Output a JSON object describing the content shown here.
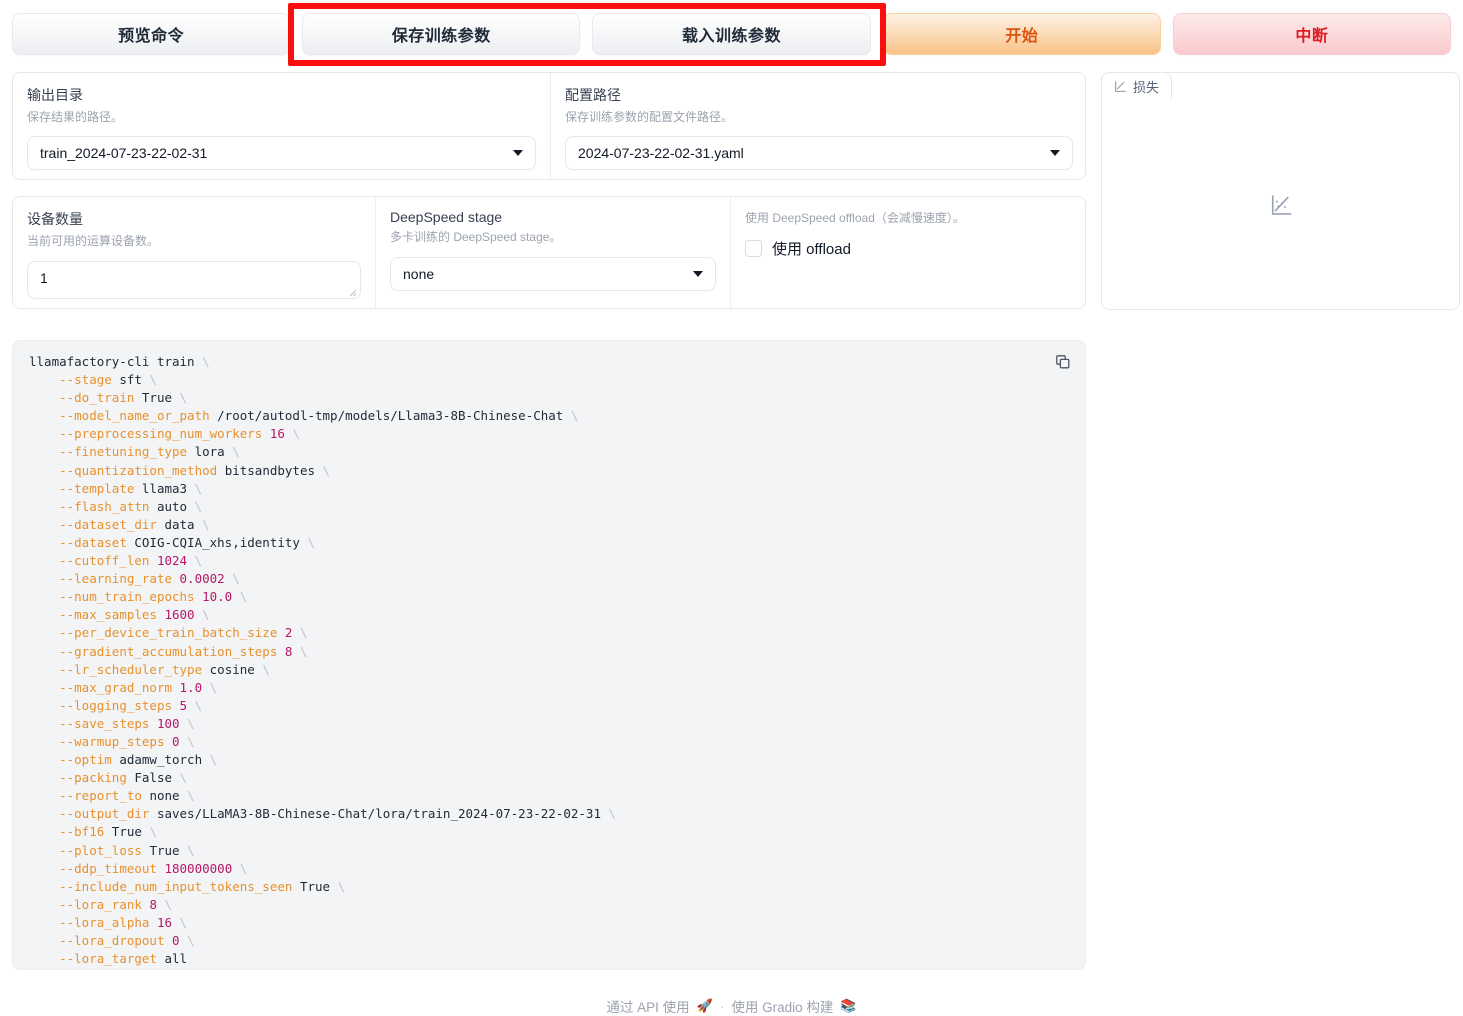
{
  "toolbar": {
    "buttons": [
      {
        "label": "预览命令",
        "style": "grey"
      },
      {
        "label": "保存训练参数",
        "style": "grey"
      },
      {
        "label": "载入训练参数",
        "style": "grey"
      },
      {
        "label": "开始",
        "style": "primary"
      },
      {
        "label": "中断",
        "style": "stop"
      }
    ],
    "annotation_color": "#fa0f0f"
  },
  "output_dir": {
    "label": "输出目录",
    "info": "保存结果的路径。",
    "value": "train_2024-07-23-22-02-31",
    "icon": "chevron-down-icon"
  },
  "config_path": {
    "label": "配置路径",
    "info": "保存训练参数的配置文件路径。",
    "value": "2024-07-23-22-02-31.yaml",
    "icon": "chevron-down-icon"
  },
  "device_count": {
    "label": "设备数量",
    "info": "当前可用的运算设备数。",
    "value": "1"
  },
  "deepspeed_stage": {
    "label": "DeepSpeed stage",
    "info": "多卡训练的 DeepSpeed stage。",
    "value": "none",
    "icon": "chevron-down-icon"
  },
  "offload": {
    "info": "使用 DeepSpeed offload（会减慢速度）。",
    "checkbox_label": "使用 offload",
    "checked": false
  },
  "loss_panel": {
    "tab_label": "损失",
    "tab_icon": "line-chart-icon",
    "placeholder_icon": "line-chart-icon"
  },
  "command": {
    "copy_icon": "copy-icon",
    "lines": [
      {
        "indent": 0,
        "flag": "llamafactory-cli",
        "value": "train",
        "cont": true,
        "flag_plain": true
      },
      {
        "indent": 1,
        "flag": "--stage",
        "value": "sft",
        "cont": true
      },
      {
        "indent": 1,
        "flag": "--do_train",
        "value": "True",
        "cont": true
      },
      {
        "indent": 1,
        "flag": "--model_name_or_path",
        "value": "/root/autodl-tmp/models/Llama3-8B-Chinese-Chat",
        "cont": true
      },
      {
        "indent": 1,
        "flag": "--preprocessing_num_workers",
        "value": "16",
        "num": true,
        "cont": true
      },
      {
        "indent": 1,
        "flag": "--finetuning_type",
        "value": "lora",
        "cont": true
      },
      {
        "indent": 1,
        "flag": "--quantization_method",
        "value": "bitsandbytes",
        "cont": true
      },
      {
        "indent": 1,
        "flag": "--template",
        "value": "llama3",
        "cont": true
      },
      {
        "indent": 1,
        "flag": "--flash_attn",
        "value": "auto",
        "cont": true
      },
      {
        "indent": 1,
        "flag": "--dataset_dir",
        "value": "data",
        "cont": true
      },
      {
        "indent": 1,
        "flag": "--dataset",
        "value": "COIG-CQIA_xhs,identity",
        "cont": true
      },
      {
        "indent": 1,
        "flag": "--cutoff_len",
        "value": "1024",
        "num": true,
        "cont": true
      },
      {
        "indent": 1,
        "flag": "--learning_rate",
        "value": "0.0002",
        "num": true,
        "cont": true
      },
      {
        "indent": 1,
        "flag": "--num_train_epochs",
        "value": "10.0",
        "num": true,
        "cont": true
      },
      {
        "indent": 1,
        "flag": "--max_samples",
        "value": "1600",
        "num": true,
        "cont": true
      },
      {
        "indent": 1,
        "flag": "--per_device_train_batch_size",
        "value": "2",
        "num": true,
        "cont": true
      },
      {
        "indent": 1,
        "flag": "--gradient_accumulation_steps",
        "value": "8",
        "num": true,
        "cont": true
      },
      {
        "indent": 1,
        "flag": "--lr_scheduler_type",
        "value": "cosine",
        "cont": true
      },
      {
        "indent": 1,
        "flag": "--max_grad_norm",
        "value": "1.0",
        "num": true,
        "cont": true
      },
      {
        "indent": 1,
        "flag": "--logging_steps",
        "value": "5",
        "num": true,
        "cont": true
      },
      {
        "indent": 1,
        "flag": "--save_steps",
        "value": "100",
        "num": true,
        "cont": true
      },
      {
        "indent": 1,
        "flag": "--warmup_steps",
        "value": "0",
        "num": true,
        "cont": true
      },
      {
        "indent": 1,
        "flag": "--optim",
        "value": "adamw_torch",
        "cont": true
      },
      {
        "indent": 1,
        "flag": "--packing",
        "value": "False",
        "cont": true
      },
      {
        "indent": 1,
        "flag": "--report_to",
        "value": "none",
        "cont": true
      },
      {
        "indent": 1,
        "flag": "--output_dir",
        "value": "saves/LLaMA3-8B-Chinese-Chat/lora/train_2024-07-23-22-02-31",
        "cont": true
      },
      {
        "indent": 1,
        "flag": "--bf16",
        "value": "True",
        "cont": true
      },
      {
        "indent": 1,
        "flag": "--plot_loss",
        "value": "True",
        "cont": true
      },
      {
        "indent": 1,
        "flag": "--ddp_timeout",
        "value": "180000000",
        "num": true,
        "cont": true
      },
      {
        "indent": 1,
        "flag": "--include_num_input_tokens_seen",
        "value": "True",
        "cont": true
      },
      {
        "indent": 1,
        "flag": "--lora_rank",
        "value": "8",
        "num": true,
        "cont": true
      },
      {
        "indent": 1,
        "flag": "--lora_alpha",
        "value": "16",
        "num": true,
        "cont": true
      },
      {
        "indent": 1,
        "flag": "--lora_dropout",
        "value": "0",
        "num": true,
        "cont": true
      },
      {
        "indent": 1,
        "flag": "--lora_target",
        "value": "all",
        "cont": false
      }
    ]
  },
  "footer": {
    "api_label": "通过 API 使用",
    "api_emoji": "🚀",
    "separator": "·",
    "built_label": "使用 Gradio 构建",
    "built_emoji": "📚"
  }
}
